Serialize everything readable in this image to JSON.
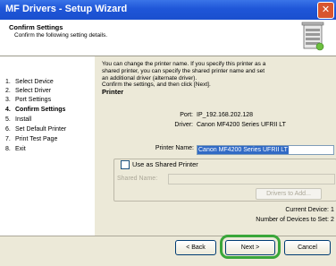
{
  "window": {
    "title": "MF Drivers - Setup Wizard",
    "close_glyph": "✕"
  },
  "header": {
    "title": "Confirm Settings",
    "subtitle": "Confirm the following setting details."
  },
  "steps": [
    {
      "num": "1.",
      "label": "Select Device",
      "active": false
    },
    {
      "num": "2.",
      "label": "Select Driver",
      "active": false
    },
    {
      "num": "3.",
      "label": "Port Settings",
      "active": false
    },
    {
      "num": "4.",
      "label": "Confirm Settings",
      "active": true
    },
    {
      "num": "5.",
      "label": "Install",
      "active": false
    },
    {
      "num": "6.",
      "label": "Set Default Printer",
      "active": false
    },
    {
      "num": "7.",
      "label": "Print Test Page",
      "active": false
    },
    {
      "num": "8.",
      "label": "Exit",
      "active": false
    }
  ],
  "instructions": {
    "line1": "You can change the printer name. If you specify this printer as a",
    "line2": "shared printer, you can specify the shared printer name and set",
    "line3": "an additional driver (alternate driver).",
    "line4": "Confirm the settings, and then click [Next]."
  },
  "printer": {
    "section_label": "Printer",
    "port_label": "Port:",
    "port_value": "IP_192.168.202.128",
    "driver_label": "Driver:",
    "driver_value": "Canon MF4200 Series UFRII LT",
    "name_label": "Printer Name:",
    "name_value": "Canon MF4200 Series UFRII LT"
  },
  "shared": {
    "checkbox_label": "Use as Shared Printer",
    "checked": false,
    "name_label": "Shared Name:",
    "name_value": "",
    "drivers_button": "Drivers to Add..."
  },
  "summary": {
    "current_device_label": "Current Device:",
    "current_device_value": "1",
    "devices_to_set_label": "Number of Devices to Set:",
    "devices_to_set_value": "2"
  },
  "buttons": {
    "back": "< Back",
    "next": "Next >",
    "cancel": "Cancel"
  },
  "colors": {
    "highlight_ring": "#3aa63a",
    "titlebar": "#1f56d8",
    "selection": "#316ac5"
  }
}
